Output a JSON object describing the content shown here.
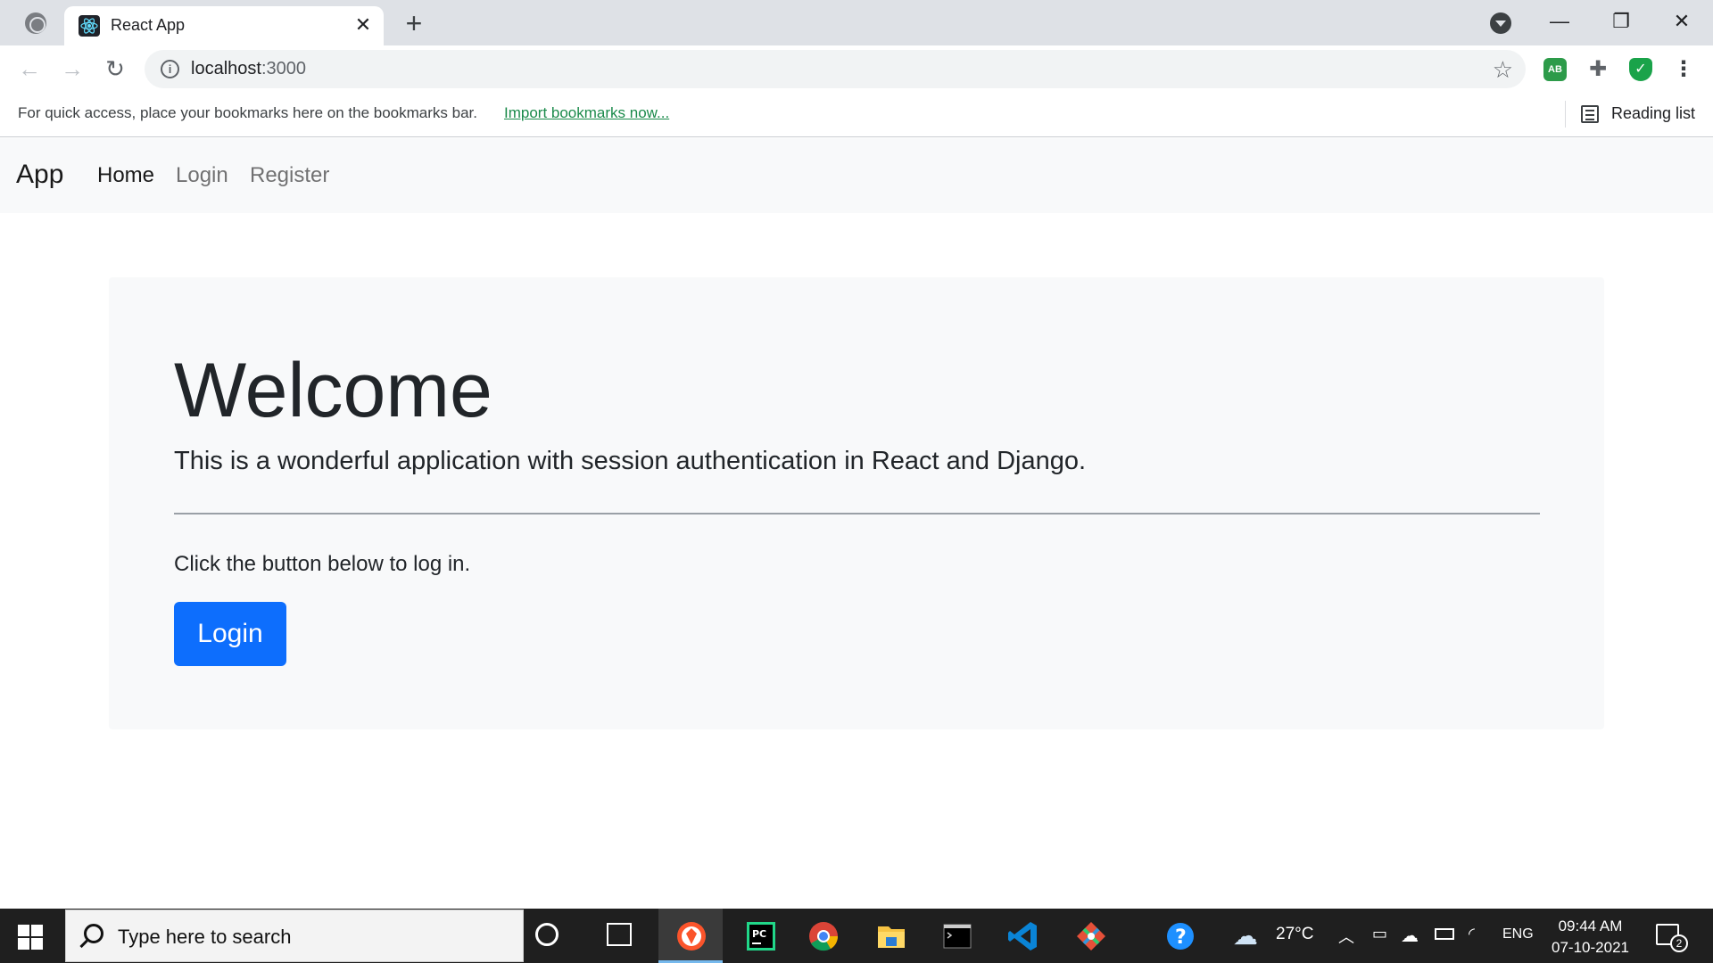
{
  "browser": {
    "tab_title": "React App",
    "url_host": "localhost",
    "url_port": ":3000",
    "bookmarks_hint": "For quick access, place your bookmarks here on the bookmarks bar.",
    "bookmarks_link": "Import bookmarks now...",
    "reading_list": "Reading list",
    "extension_ab": "AB"
  },
  "navbar": {
    "brand": "App",
    "links": [
      "Home",
      "Login",
      "Register"
    ],
    "active": "Home"
  },
  "jumbotron": {
    "title": "Welcome",
    "lead": "This is a wonderful application with session authentication in React and Django.",
    "text": "Click the button below to log in.",
    "button": "Login"
  },
  "taskbar": {
    "search_placeholder": "Type here to search",
    "temperature": "27°C",
    "language": "ENG",
    "time": "09:44 AM",
    "date": "07-10-2021",
    "notification_count": "2"
  },
  "colors": {
    "primary": "#0d6efd",
    "navbar_bg": "#f8f9fa",
    "link_green": "#1a8a4a"
  }
}
